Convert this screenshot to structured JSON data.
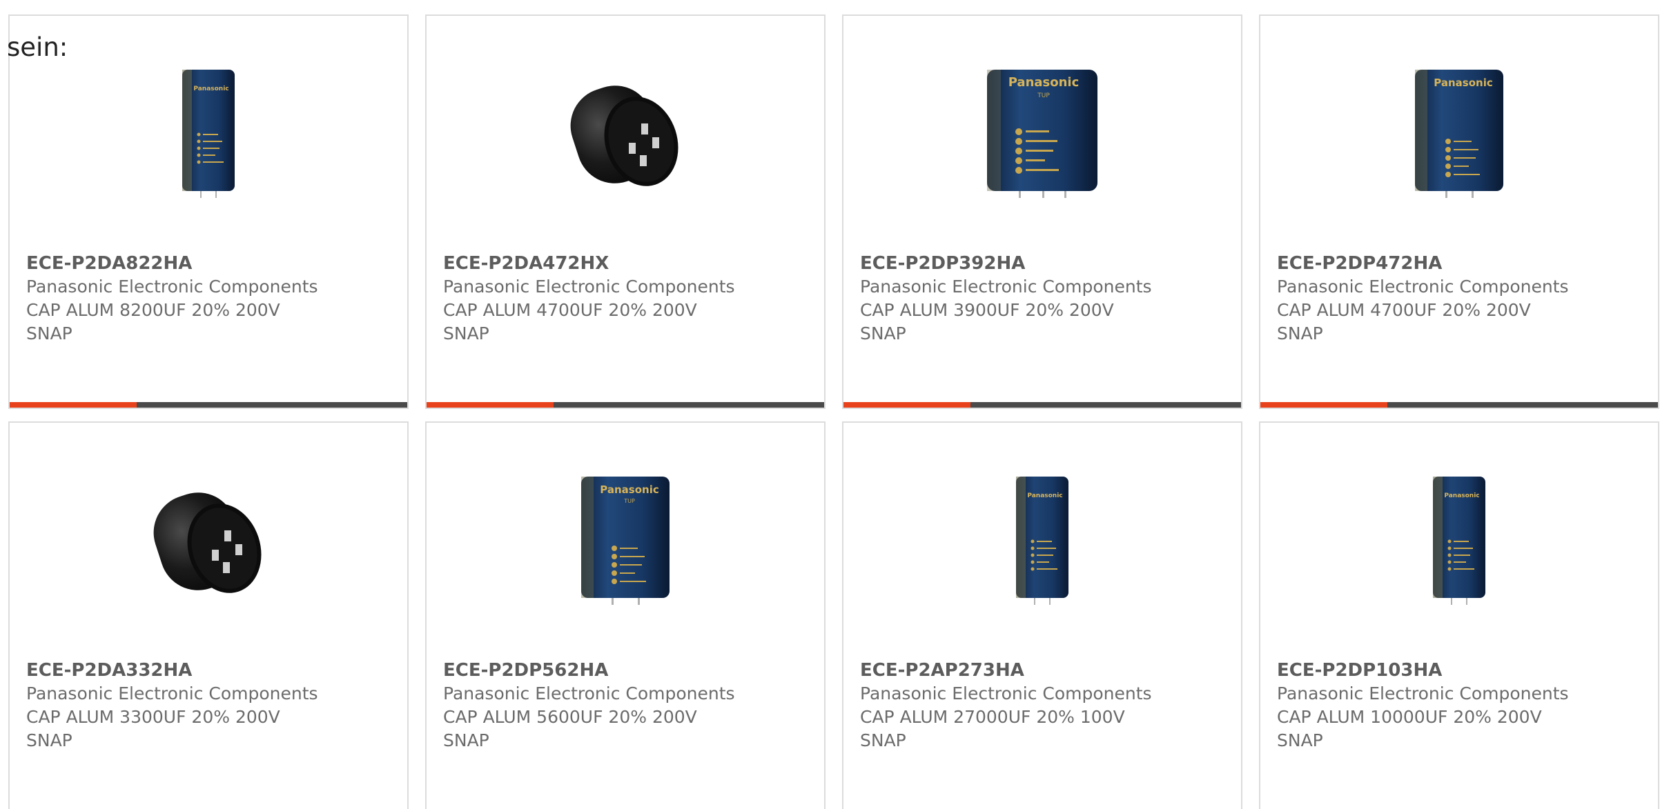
{
  "intro_text": "sein:",
  "colors": {
    "accent": "#e8421c",
    "bar_dark": "#4a4a4a",
    "card_border": "#dcdcdc",
    "text": "#6b6b6b"
  },
  "products": [
    {
      "part": "ECE-P2DA822HA",
      "maker": "Panasonic Electronic Components",
      "desc": "CAP ALUM 8200UF 20% 200V",
      "desc2": "SNAP",
      "image": "tall-blue-capacitor",
      "hover_bar": true
    },
    {
      "part": "ECE-P2DA472HX",
      "maker": "Panasonic Electronic Components",
      "desc": "CAP ALUM 4700UF 20% 200V",
      "desc2": "SNAP",
      "image": "black-capacitor-terminals",
      "hover_bar": true
    },
    {
      "part": "ECE-P2DP392HA",
      "maker": "Panasonic Electronic Components",
      "desc": "CAP ALUM 3900UF 20% 200V",
      "desc2": "SNAP",
      "image": "wide-blue-capacitor",
      "hover_bar": true
    },
    {
      "part": "ECE-P2DP472HA",
      "maker": "Panasonic Electronic Components",
      "desc": "CAP ALUM 4700UF 20% 200V",
      "desc2": "SNAP",
      "image": "medium-blue-capacitor",
      "hover_bar": true
    },
    {
      "part": "ECE-P2DA332HA",
      "maker": "Panasonic Electronic Components",
      "desc": "CAP ALUM 3300UF 20% 200V",
      "desc2": "SNAP",
      "image": "black-capacitor-terminals",
      "hover_bar": false
    },
    {
      "part": "ECE-P2DP562HA",
      "maker": "Panasonic Electronic Components",
      "desc": "CAP ALUM 5600UF 20% 200V",
      "desc2": "SNAP",
      "image": "medium-blue-capacitor",
      "hover_bar": false
    },
    {
      "part": "ECE-P2AP273HA",
      "maker": "Panasonic Electronic Components",
      "desc": "CAP ALUM 27000UF 20% 100V",
      "desc2": "SNAP",
      "image": "tall-blue-capacitor",
      "hover_bar": false
    },
    {
      "part": "ECE-P2DP103HA",
      "maker": "Panasonic Electronic Components",
      "desc": "CAP ALUM 10000UF 20% 200V",
      "desc2": "SNAP",
      "image": "tall-blue-capacitor",
      "hover_bar": false
    }
  ]
}
